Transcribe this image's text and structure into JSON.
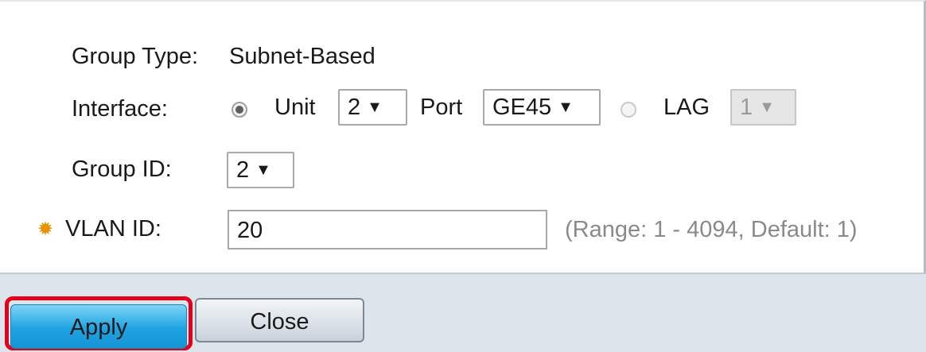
{
  "form": {
    "group_type": {
      "label": "Group Type:",
      "value": "Subnet-Based"
    },
    "interface": {
      "label": "Interface:",
      "unit_label": "Unit",
      "unit_value": "2",
      "port_label": "Port",
      "port_value": "GE45",
      "lag_label": "LAG",
      "lag_value": "1",
      "selected": "unit"
    },
    "group_id": {
      "label": "Group ID:",
      "value": "2"
    },
    "vlan_id": {
      "label": "VLAN ID:",
      "value": "20",
      "hint": "(Range: 1 - 4094, Default: 1)",
      "required_icon": "gear-icon"
    }
  },
  "buttons": {
    "apply": "Apply",
    "close": "Close"
  },
  "colors": {
    "required": "#e69500",
    "highlight": "#e3001b",
    "apply": "#1ea3e3"
  }
}
